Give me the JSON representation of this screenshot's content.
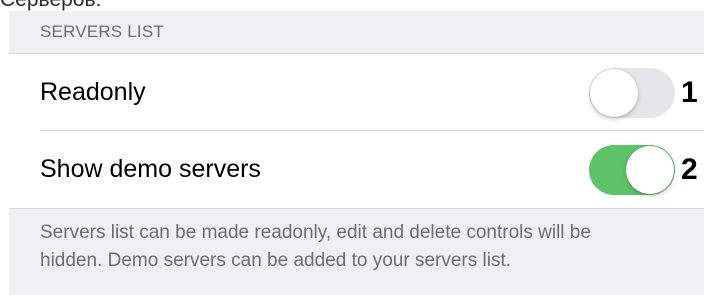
{
  "clipped_heading": "Серверов:",
  "section": {
    "header": "SERVERS LIST",
    "rows": [
      {
        "label": "Readonly",
        "toggle_on": false,
        "callout": "1"
      },
      {
        "label": "Show demo servers",
        "toggle_on": true,
        "callout": "2"
      }
    ],
    "footer": "Servers list can be made readonly, edit and delete controls will be hidden. Demo servers can be added to your servers list."
  },
  "colors": {
    "toggle_on": "#5fc467",
    "toggle_off": "#e5e5ea",
    "group_background": "#efeff4",
    "secondary_text": "#6d6d72"
  }
}
